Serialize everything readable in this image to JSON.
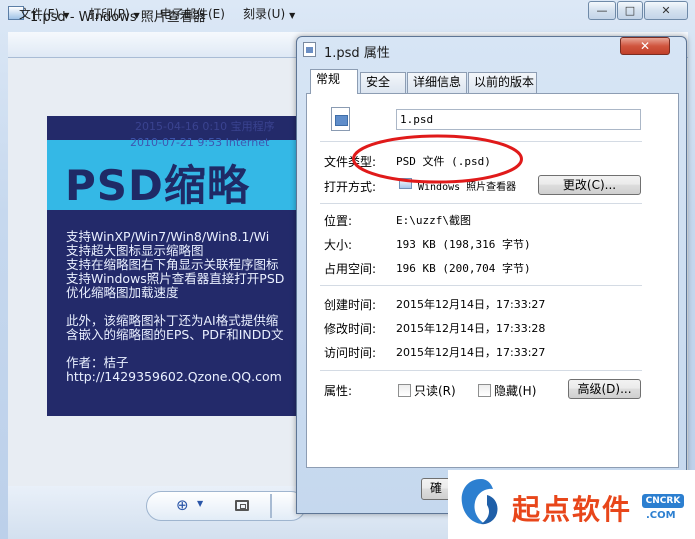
{
  "viewer": {
    "title": "1.psd - Windows 照片查看器",
    "window_buttons": {
      "minimize": "—",
      "maximize": "□",
      "close": "✕"
    },
    "menu": [
      "文件(F)",
      "打印(P)",
      "电子邮件(E)",
      "刻录(U)"
    ],
    "image": {
      "ghost_line1": "2015-04-16 0:10    宝用程序",
      "ghost_line2": "2010-07-21 9:53    Internet",
      "heading": "PSD缩略",
      "lines": [
        "支持WinXP/Win7/Win8/Win8.1/Wi",
        "支持超大图标显示缩略图",
        "支持在缩略图右下角显示关联程序图标",
        "支持Windows照片查看器直接打开PSD",
        "优化缩略图加载速度",
        "",
        "此外，该缩略图补丁还为AI格式提供缩",
        "含嵌入的缩略图的EPS、PDF和INDD文",
        "",
        "作者：桔子",
        "http://1429359602.Qzone.QQ.com"
      ]
    },
    "toolbar": {
      "zoom_icon": "magnifier-plus-icon",
      "fit_icon": "fit-window-icon"
    }
  },
  "dialog": {
    "title": "1.psd 属性",
    "close_label": "✕",
    "tabs": [
      "常规",
      "安全",
      "详细信息",
      "以前的版本"
    ],
    "filename": "1.psd",
    "file_type_label": "文件类型:",
    "file_type_value": "PSD 文件 (.psd)",
    "opens_with_label": "打开方式:",
    "opens_with_value": "Windows 照片查看器",
    "change_button": "更改(C)...",
    "location_label": "位置:",
    "location_value": "E:\\uzzf\\截图",
    "size_label": "大小:",
    "size_value": "193 KB (198,316 字节)",
    "size_on_disk_label": "占用空间:",
    "size_on_disk_value": "196 KB (200,704 字节)",
    "created_label": "创建时间:",
    "created_value": "2015年12月14日，17:33:27",
    "modified_label": "修改时间:",
    "modified_value": "2015年12月14日，17:33:28",
    "accessed_label": "访问时间:",
    "accessed_value": "2015年12月14日，17:33:27",
    "attributes_label": "属性:",
    "readonly_label": "只读(R)",
    "hidden_label": "隐藏(H)",
    "advanced_button": "高级(D)...",
    "bottom_button": "確"
  },
  "watermark": {
    "text": "起点软件",
    "badge": "CNCRK",
    "domain": ".COM"
  },
  "colors": {
    "annotation_ellipse": "#e01a1a",
    "watermark_orange": "#e8461a",
    "watermark_blue": "#2c7fd0",
    "image_background": "#232a6a",
    "image_band": "#34b8e6"
  }
}
